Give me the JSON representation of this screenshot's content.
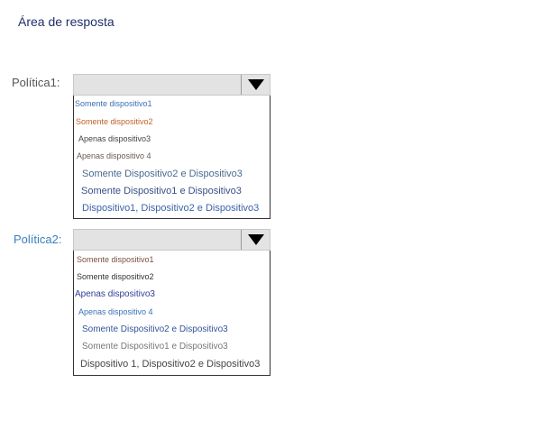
{
  "title": "Área de resposta",
  "policies": [
    {
      "label": "Política1:",
      "label_color": "#555555",
      "items": [
        {
          "text": "Somente dispositivo1",
          "color": "#3a6fb5"
        },
        {
          "text": "Somente dispositivo2",
          "color": "#c0622a"
        },
        {
          "text": "Apenas dispositivo3",
          "color": "#444444"
        },
        {
          "text": "Apenas dispositivo 4",
          "color": "#6b5a55"
        },
        {
          "text": "Somente Dispositivo2 e Dispositivo3",
          "color": "#4a6b8f"
        },
        {
          "text": "Somente Dispositivo1 e Dispositivo3",
          "color": "#37508a"
        },
        {
          "text": "Dispositivo1, Dispositivo2 e Dispositivo3",
          "color": "#3a64a8"
        }
      ]
    },
    {
      "label": "Política2:",
      "label_color": "#3a7fc1",
      "items": [
        {
          "text": "Somente dispositivo1",
          "color": "#7a5040"
        },
        {
          "text": "Somente dispositivo2",
          "color": "#333333"
        },
        {
          "text": "Apenas dispositivo3",
          "color": "#2f3f95"
        },
        {
          "text": "Apenas dispositivo 4",
          "color": "#3a70b8"
        },
        {
          "text": "Somente Dispositivo2 e Dispositivo3",
          "color": "#34539a"
        },
        {
          "text": "Somente Dispositivo1 e Dispositivo3",
          "color": "#777777"
        },
        {
          "text": "Dispositivo 1, Dispositivo2 e Dispositivo3",
          "color": "#444444"
        }
      ]
    }
  ]
}
